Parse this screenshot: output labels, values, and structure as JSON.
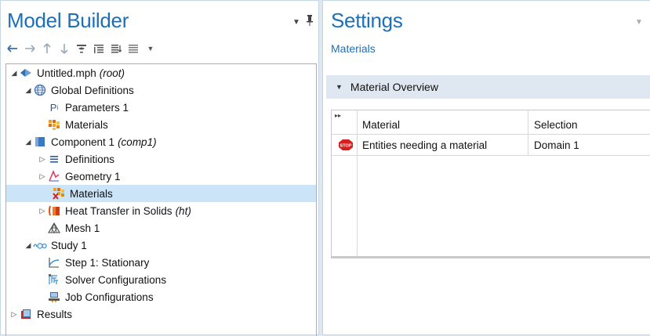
{
  "model_builder": {
    "title": "Model Builder",
    "toolbar": [
      "arrow-left-icon",
      "arrow-right-icon",
      "arrow-up-icon",
      "arrow-down-icon",
      "show-icon",
      "collapse-icon",
      "expand-icon",
      "list-icon",
      "dropdown-icon"
    ],
    "tree": [
      {
        "label": "Untitled.mph",
        "suffix": "(root)",
        "icon": "model-icon",
        "twisty": "expanded"
      },
      {
        "label": "Global Definitions",
        "suffix": "",
        "icon": "globe-icon",
        "twisty": "expanded"
      },
      {
        "label": "Parameters 1",
        "suffix": "",
        "icon": "parameters-icon",
        "twisty": ""
      },
      {
        "label": "Materials",
        "suffix": "",
        "icon": "materials-icon",
        "twisty": ""
      },
      {
        "label": "Component 1",
        "suffix": "(comp1)",
        "icon": "component-icon",
        "twisty": "expanded"
      },
      {
        "label": "Definitions",
        "suffix": "",
        "icon": "definitions-icon",
        "twisty": "collapsed"
      },
      {
        "label": "Geometry 1",
        "suffix": "",
        "icon": "geometry-icon",
        "twisty": "collapsed"
      },
      {
        "label": "Materials",
        "suffix": "",
        "icon": "materials-error-icon",
        "twisty": "",
        "selected": true
      },
      {
        "label": "Heat Transfer in Solids",
        "suffix": "(ht)",
        "icon": "heat-transfer-icon",
        "twisty": "collapsed"
      },
      {
        "label": "Mesh 1",
        "suffix": "",
        "icon": "mesh-icon",
        "twisty": ""
      },
      {
        "label": "Study 1",
        "suffix": "",
        "icon": "study-icon",
        "twisty": "expanded"
      },
      {
        "label": "Step 1: Stationary",
        "suffix": "",
        "icon": "stationary-icon",
        "twisty": ""
      },
      {
        "label": "Solver Configurations",
        "suffix": "",
        "icon": "solver-icon",
        "twisty": ""
      },
      {
        "label": "Job Configurations",
        "suffix": "",
        "icon": "job-icon",
        "twisty": ""
      },
      {
        "label": "Results",
        "suffix": "",
        "icon": "results-icon",
        "twisty": "collapsed"
      }
    ]
  },
  "settings": {
    "title": "Settings",
    "subtitle": "Materials",
    "section": "Material Overview",
    "table": {
      "headers": [
        "Material",
        "Selection"
      ],
      "rows": [
        {
          "icon": "stop-icon",
          "material": "Entities needing a material",
          "selection": "Domain 1"
        }
      ]
    }
  },
  "colors": {
    "accent": "#1e6fb8",
    "selection": "#cce4f7",
    "stop": "#d42020"
  }
}
